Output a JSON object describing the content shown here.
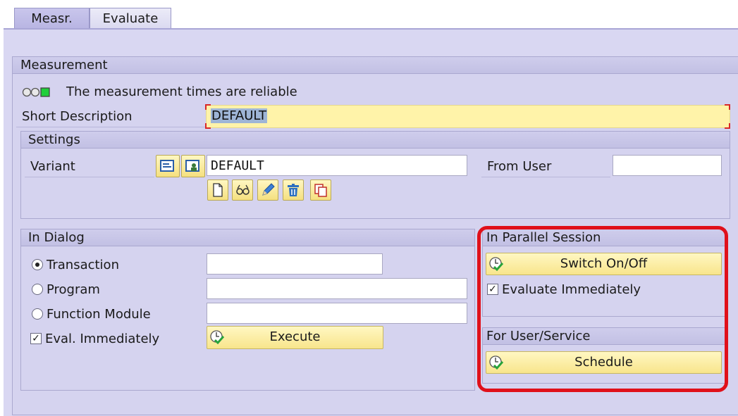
{
  "tabs": [
    {
      "label": "Measr.",
      "active": true
    },
    {
      "label": "Evaluate",
      "active": false
    }
  ],
  "measurement": {
    "title": "Measurement",
    "status_text": "The measurement times are reliable",
    "status_icon": "traffic-light-green-icon",
    "short_description_label": "Short Description",
    "short_description_value": "DEFAULT"
  },
  "settings": {
    "title": "Settings",
    "variant_label": "Variant",
    "variant_value": "DEFAULT",
    "from_user_label": "From User",
    "from_user_value": "",
    "variant_icons": [
      "variant-get-icon",
      "variant-user-icon"
    ],
    "tool_icons": [
      "create-icon",
      "display-icon",
      "edit-icon",
      "delete-icon",
      "copy-icon"
    ]
  },
  "in_dialog": {
    "title": "In Dialog",
    "options": [
      {
        "label": "Transaction",
        "selected": true,
        "value": ""
      },
      {
        "label": "Program",
        "selected": false,
        "value": ""
      },
      {
        "label": "Function Module",
        "selected": false,
        "value": ""
      }
    ],
    "eval_immediately_label": "Eval. Immediately",
    "eval_immediately_checked": true,
    "execute_label": "Execute"
  },
  "parallel_session": {
    "title": "In Parallel Session",
    "switch_label": "Switch On/Off",
    "evaluate_label": "Evaluate Immediately",
    "evaluate_checked": true
  },
  "user_service": {
    "title": "For User/Service",
    "schedule_label": "Schedule"
  },
  "colors": {
    "background": "#d9d7f2",
    "button": "#f8e58c",
    "highlight": "#e0101a",
    "status_green": "#1fcf3a"
  }
}
